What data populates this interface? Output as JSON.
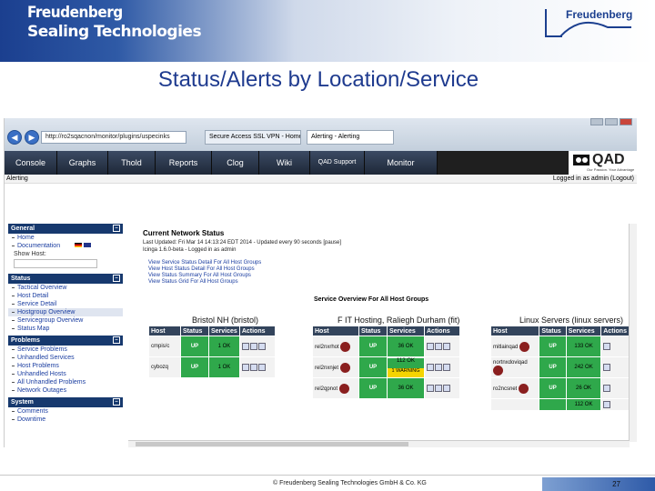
{
  "banner": {
    "brand_line1": "Freudenberg",
    "brand_line2": "Sealing Technologies",
    "logo_text": "Freudenberg"
  },
  "slide_title": "Status/Alerts by Location/Service",
  "browser": {
    "address": "http://ro2sqacnon/monitor/plugins/uspecinks",
    "tabs": [
      "Secure Access SSL VPN - Home",
      "Alerting - Alerting"
    ]
  },
  "qad_nav": [
    "Console",
    "Graphs",
    "Thold",
    "Reports",
    "Clog",
    "Wiki",
    "QAD Support",
    "Monitor"
  ],
  "qad_logo": {
    "name": "QAD",
    "tagline": "Our Passion. Your Advantage"
  },
  "subbar": {
    "left": "Alerting",
    "right": "Logged in as admin (Logout)"
  },
  "sidebar": {
    "general": {
      "title": "General",
      "items": [
        "Home",
        "Documentation"
      ],
      "show_host": "Show Host:"
    },
    "status": {
      "title": "Status",
      "items": [
        "Tactical Overview",
        "Host Detail",
        "Service Detail",
        "Hostgroup Overview",
        "Servicegroup Overview",
        "Status Map"
      ]
    },
    "problems": {
      "title": "Problems",
      "items": [
        "Service Problems",
        "Unhandled Services",
        "Host Problems",
        "Unhandled Hosts",
        "All Unhandled Problems",
        "Network Outages"
      ]
    },
    "system": {
      "title": "System",
      "items": [
        "Comments",
        "Downtime"
      ]
    }
  },
  "content": {
    "title": "Current Network Status",
    "meta": [
      "Last Updated: Fri Mar 14 14:13:24 EDT 2014 - Updated every 90 seconds [pause]",
      "Icinga 1.6.0-beta - Logged in as admin"
    ],
    "links": [
      "View Service Status Detail For All Host Groups",
      "View Host Status Detail For All Host Groups",
      "View Status Summary For All Host Groups",
      "View Status Grid For All Host Groups"
    ],
    "overview_title": "Service Overview For All Host Groups",
    "headers": [
      "Host",
      "Status",
      "Services",
      "Actions"
    ],
    "groups": [
      {
        "title": "Bristol NH (bristol)",
        "rows": [
          {
            "host": "cmpis/c",
            "status": "UP",
            "services": [
              "1 OK"
            ]
          },
          {
            "host": "cybozq",
            "status": "UP",
            "services": [
              "1 OK"
            ]
          }
        ]
      },
      {
        "title": "F IT Hosting, Raliegh Durham (fit)",
        "rows": [
          {
            "host": "rel2nxrhot",
            "status": "UP",
            "services": [
              "36 OK"
            ]
          },
          {
            "host": "rel2nxnjet",
            "status": "UP",
            "services": [
              "112 OK",
              "1 WARNING"
            ]
          },
          {
            "host": "rel2qpnot",
            "status": "UP",
            "services": [
              "36 OK"
            ]
          }
        ]
      },
      {
        "title": "Linux Servers (linux servers)",
        "rows": [
          {
            "host": "mitlainqad",
            "status": "UP",
            "services": [
              "133 OK"
            ]
          },
          {
            "host": "nortnxdoviqad",
            "status": "UP",
            "services": [
              "242 OK"
            ]
          },
          {
            "host": "ro2ncsnet",
            "status": "UP",
            "services": [
              "26 OK"
            ]
          },
          {
            "host": "",
            "status": "",
            "services": [
              "112 OK"
            ]
          }
        ]
      }
    ]
  },
  "footer": {
    "text": "© Freudenberg Sealing Technologies GmbH & Co. KG",
    "page": "27"
  },
  "colors": {
    "brand_blue": "#1b3f8f",
    "ok_green": "#2fa84b",
    "warning_yellow": "#f5d400",
    "nav_dark": "#1e2838"
  }
}
